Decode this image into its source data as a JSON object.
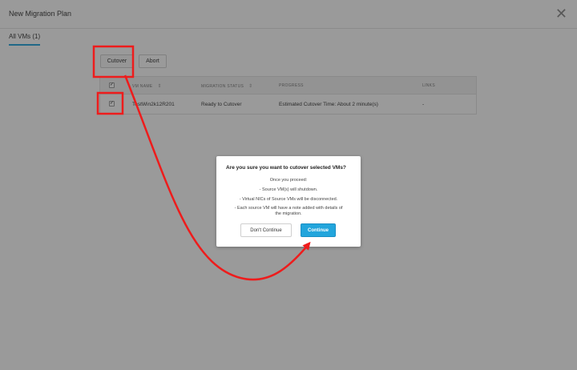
{
  "window": {
    "title": "New Migration Plan",
    "close_glyph": "✕"
  },
  "tabs": [
    {
      "label": "All VMs (1)"
    }
  ],
  "toolbar": {
    "cutover_label": "Cutover",
    "abort_label": "Abort"
  },
  "table": {
    "columns": [
      "VM NAME",
      "MIGRATION STATUS",
      "PROGRESS",
      "LINKS"
    ],
    "rows": [
      {
        "vm_name": "TestWin2k12R201",
        "status": "Ready to Cutover",
        "progress": "Estimated Cutover Time: About 2 minute(s)",
        "links": "-"
      }
    ]
  },
  "dialog": {
    "title": "Are you sure you want to cutover selected VMs?",
    "intro": "Once you proceed:",
    "bullets": [
      "- Source VM(s) will shutdown.",
      "- Virtual NICs of Source VMs will be disconnected.",
      "- Each source VM will have a note added with details of the migration."
    ],
    "dont_continue_label": "Don't Continue",
    "continue_label": "Continue"
  },
  "colors": {
    "accent": "#22a5dc",
    "annotation": "#ee1c1c",
    "overlay": "#5a5a5a"
  }
}
